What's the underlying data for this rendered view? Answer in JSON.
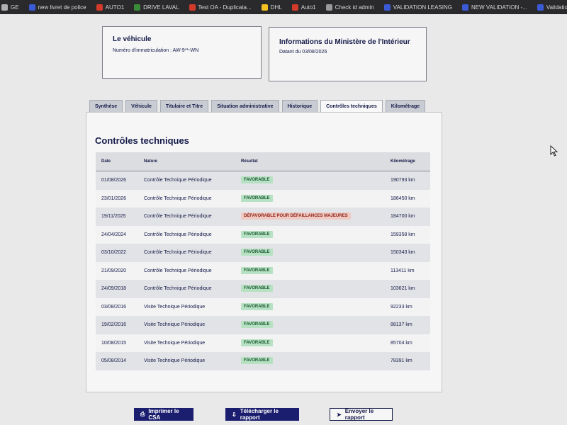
{
  "bookmarks": [
    {
      "label": "GE",
      "color": "#b0b0b0"
    },
    {
      "label": "new livret de police",
      "color": "#3b5bd6"
    },
    {
      "label": "AUTO1",
      "color": "#d43a2a"
    },
    {
      "label": "DRIVE LAVAL",
      "color": "#3a8a3a"
    },
    {
      "label": "Test OA - Duplicata...",
      "color": "#d43a2a"
    },
    {
      "label": "DHL",
      "color": "#f4c020"
    },
    {
      "label": "Auto1",
      "color": "#d43a2a"
    },
    {
      "label": "Check id admin",
      "color": "#9a9a9a"
    },
    {
      "label": "VALIDATION LEASING",
      "color": "#3b5bd6"
    },
    {
      "label": "NEW VALIDATION -...",
      "color": "#3b5bd6"
    },
    {
      "label": "Validations l",
      "color": "#3b5bd6"
    }
  ],
  "vehicule": {
    "title": "Le véhicule",
    "immat": "Numéro d'immatriculation : AW-9**-WN"
  },
  "ministere": {
    "title": "Informations du Ministère de l'Intérieur",
    "date": "Datant du 03/08/2026"
  },
  "tabs": [
    {
      "label": "Synthèse",
      "active": false
    },
    {
      "label": "Véhicule",
      "active": false
    },
    {
      "label": "Titulaire et Titre",
      "active": false
    },
    {
      "label": "Situation administrative",
      "active": false
    },
    {
      "label": "Historique",
      "active": false
    },
    {
      "label": "Contrôles techniques",
      "active": true
    },
    {
      "label": "Kilométrage",
      "active": false
    }
  ],
  "section": {
    "title": "Contrôles techniques",
    "headers": {
      "date": "Date",
      "nature": "Nature",
      "resultat": "Résultat",
      "km": "Kilométrage"
    },
    "rows": [
      {
        "date": "01/08/2026",
        "nature": "Contrôle Technique Périodique",
        "resultat": "FAVORABLE",
        "status": "ok",
        "km": "190793 km"
      },
      {
        "date": "23/01/2026",
        "nature": "Contrôle Technique Périodique",
        "resultat": "FAVORABLE",
        "status": "ok",
        "km": "186450 km"
      },
      {
        "date": "19/11/2025",
        "nature": "Contrôle Technique Périodique",
        "resultat": "DÉFAVORABLE POUR DÉFAILLANCES MAJEURES",
        "status": "ko",
        "km": "184700 km"
      },
      {
        "date": "24/04/2024",
        "nature": "Contrôle Technique Périodique",
        "resultat": "FAVORABLE",
        "status": "ok",
        "km": "159358 km"
      },
      {
        "date": "03/10/2022",
        "nature": "Contrôle Technique Périodique",
        "resultat": "FAVORABLE",
        "status": "ok",
        "km": "150343 km"
      },
      {
        "date": "21/09/2020",
        "nature": "Contrôle Technique Périodique",
        "resultat": "FAVORABLE",
        "status": "ok",
        "km": "113411 km"
      },
      {
        "date": "24/09/2018",
        "nature": "Contrôle Technique Périodique",
        "resultat": "FAVORABLE",
        "status": "ok",
        "km": "103621 km"
      },
      {
        "date": "03/08/2016",
        "nature": "Visite Technique Périodique",
        "resultat": "FAVORABLE",
        "status": "ok",
        "km": "92233 km"
      },
      {
        "date": "19/02/2016",
        "nature": "Visite Technique Périodique",
        "resultat": "FAVORABLE",
        "status": "ok",
        "km": "88137 km"
      },
      {
        "date": "10/08/2015",
        "nature": "Visite Technique Périodique",
        "resultat": "FAVORABLE",
        "status": "ok",
        "km": "85704 km"
      },
      {
        "date": "05/08/2014",
        "nature": "Visite Technique Périodique",
        "resultat": "FAVORABLE",
        "status": "ok",
        "km": "78391 km"
      }
    ]
  },
  "buttons": {
    "print": "Imprimer le CSA",
    "download": "Télécharger le rapport",
    "send": "Envoyer le rapport"
  },
  "colors": {
    "primary": "#1b1e6e",
    "favorable": "#b7e1c3",
    "defavorable": "#f0c9c2"
  }
}
